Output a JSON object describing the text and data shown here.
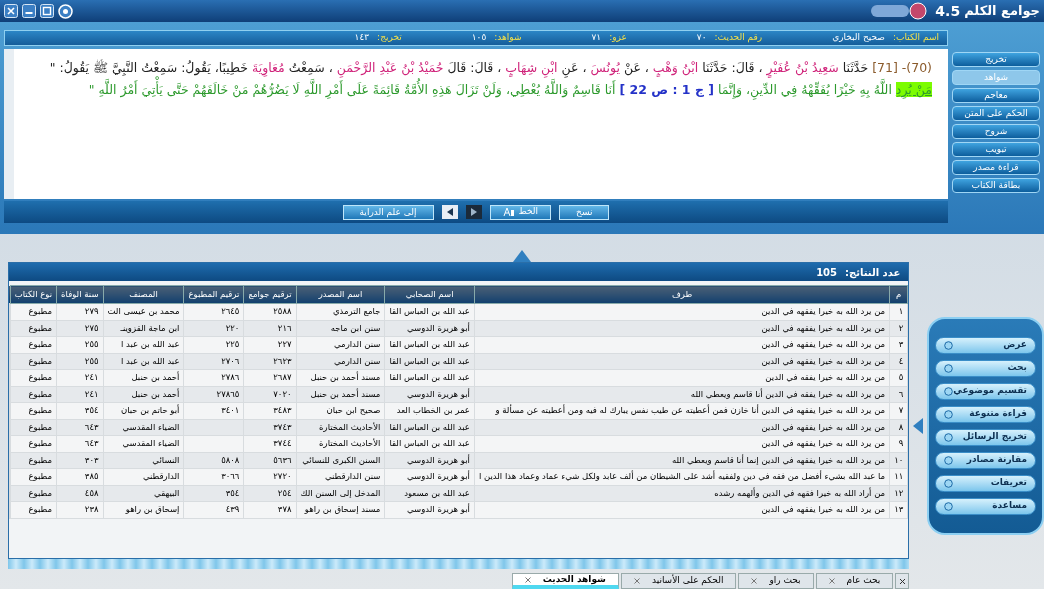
{
  "window": {
    "title": "جوامع الكلم",
    "version": "4.5"
  },
  "info_bar": [
    {
      "label": "اسم الكتاب:",
      "value": "صحيح البخاري"
    },
    {
      "label": "رقم الحديث:",
      "value": "٧٠"
    },
    {
      "label": "عزو:",
      "value": "٧١"
    },
    {
      "label": "شواهد:",
      "value": "١٠٥"
    },
    {
      "label": "تخريج:",
      "value": "١٤٣"
    }
  ],
  "hadith_text": [
    {
      "kind": "ref",
      "text": "(70)- [71]"
    },
    {
      "kind": "plain",
      "text": "حَدَّثَنَا"
    },
    {
      "kind": "narrator",
      "text": "سَعِيدُ بْنُ عُفَيْرٍ"
    },
    {
      "kind": "plain",
      "text": "، قَالَ: حَدَّثَنَا"
    },
    {
      "kind": "narrator",
      "text": "ابْنُ وَهْبٍ"
    },
    {
      "kind": "plain",
      "text": "، عَنْ"
    },
    {
      "kind": "narrator",
      "text": "يُونُسَ"
    },
    {
      "kind": "plain",
      "text": "، عَنِ"
    },
    {
      "kind": "narrator",
      "text": "ابْنِ شِهَابٍ"
    },
    {
      "kind": "plain",
      "text": "، قَالَ: قَالَ"
    },
    {
      "kind": "narrator",
      "text": "حُمَيْدُ بْنُ عَبْدِ الرَّحْمَنِ"
    },
    {
      "kind": "plain",
      "text": "، سَمِعْتُ"
    },
    {
      "kind": "narrator",
      "text": "مُعَاوِيَةَ"
    },
    {
      "kind": "plain",
      "text": "خَطِيبًا، يَقُولُ: سَمِعْتُ النَّبِيَّ ﷺ يَقُولُ: \""
    },
    {
      "kind": "highlight",
      "text": "مَنْ يُرِدِ"
    },
    {
      "kind": "matn",
      "text": "اللَّهُ بِهِ خَيْرًا يُفَقِّهْهُ فِي الدِّينِ، وَإِنَّمَا"
    },
    {
      "kind": "page",
      "text": "[ ج 1 : ص 22 ]"
    },
    {
      "kind": "matn",
      "text": "أَنَا قَاسِمٌ وَاللَّهُ يُعْطِي، وَلَنْ تَزَالَ هَذِهِ الأُمَّةُ قَائِمَةً عَلَى أَمْرِ اللَّهِ لَا يَضُرُّهُمْ مَنْ خَالَفَهُمْ حَتَّى يَأْتِيَ أَمْرُ اللَّهِ \""
    }
  ],
  "side_buttons": [
    {
      "label": "تخريج",
      "selected": false
    },
    {
      "label": "شواهد",
      "selected": true
    },
    {
      "label": "معاجم",
      "selected": false
    },
    {
      "label": "الحكم على المتن",
      "selected": false
    },
    {
      "label": "شروح",
      "selected": false
    },
    {
      "label": "تبويب",
      "selected": false
    },
    {
      "label": "قراءة مصدر",
      "selected": false
    },
    {
      "label": "بطاقة الكتاب",
      "selected": false
    }
  ],
  "toolbar": [
    {
      "kind": "text",
      "label": "نسخ"
    },
    {
      "kind": "font",
      "label": "الخط"
    },
    {
      "kind": "next"
    },
    {
      "kind": "prev"
    },
    {
      "kind": "text",
      "label": "إلى علم الدراية"
    }
  ],
  "results": {
    "count_label": "عدد النتائج:",
    "count": "105",
    "columns": [
      "م",
      "طرف",
      "اسم الصحابي",
      "اسم المصدر",
      "ترقيم جوامع",
      "ترقيم المطبوع",
      "المصنف",
      "سنة الوفاة",
      "نوع الكتاب"
    ],
    "rows": [
      [
        "١",
        "من يرد الله به خيرا يفقهه في الدين",
        "عبد الله بن العباس القا",
        "جامع الترمذي",
        "٢٥٨٨",
        "٢٦٤٥",
        "محمد بن عيسى الت",
        "٢٧٩",
        "مطبوع"
      ],
      [
        "٢",
        "من يرد الله به خيرا يفقهه في الدين",
        "أبو هريرة الدوسي",
        "سنن ابن ماجه",
        "٢١٦",
        "٢٢٠",
        "ابن ماجة القزوينـ",
        "٢٧٥",
        "مطبوع"
      ],
      [
        "٣",
        "من يرد الله به خيرا يفقهه في الدين",
        "عبد الله بن العباس القا",
        "سنن الدارمي",
        "٢٢٧",
        "٢٢٥",
        "عبد الله بن عبد ا",
        "٢٥٥",
        "مطبوع"
      ],
      [
        "٤",
        "من يرد الله به خيرا يفقهه في الدين",
        "عبد الله بن العباس القا",
        "سنن الدارمي",
        "٢٦٢٣",
        "٢٧٠٦",
        "عبد الله بن عبد ا",
        "٢٥٥",
        "مطبوع"
      ],
      [
        "٥",
        "من يرد الله به خيرا يفقه في الدين",
        "عبد الله بن العباس القا",
        "مسند أحمد بن حنبل",
        "٢٦٨٧",
        "٢٧٨٦",
        "أحمد بن حنبل",
        "٢٤١",
        "مطبوع"
      ],
      [
        "٦",
        "من يرد الله به خيرا يفقه في الدين أنا قاسم ويعطي الله",
        "أبو هريرة الدوسي",
        "مسند أحمد بن حنبل",
        "٧٠٢٠",
        "٢٧٨٦٥",
        "أحمد بن حنبل",
        "٢٤١",
        "مطبوع"
      ],
      [
        "٧",
        "من يرد الله به خيرا يفقهه في الدين أنا خازن فمن أعطيته عن طيب نفس يبارك له فيه ومن أعطيته عن مسألة و",
        "عمر بن الخطاب العد",
        "صحيح ابن حبان",
        "٣٤٨٣",
        "٣٤٠١",
        "أبو حاتم بن حبان",
        "٣٥٤",
        "مطبوع"
      ],
      [
        "٨",
        "من يرد الله به خيرا يفقهه في الدين",
        "عبد الله بن العباس القا",
        "الأحاديث المختارة",
        "٣٧٤٣",
        null,
        "الضياء المقدسي",
        "٦٤٣",
        "مطبوع"
      ],
      [
        "٩",
        "من يرد الله به خيرا يفقهه في الدين",
        "عبد الله بن العباس القا",
        "الأحاديث المختارة",
        "٣٧٤٤",
        null,
        "الضياء المقدسي",
        "٦٤٣",
        "مطبوع"
      ],
      [
        "١٠",
        "من يرد الله به خيرا يفقهه في الدين إنما أنا قاسم ويعطي الله",
        "أبو هريرة الدوسي",
        "السنن الكبرى للنسائي",
        "٥٦٣٦",
        "٥٨٠٨",
        "النسائي",
        "٣٠٣",
        "مطبوع"
      ],
      [
        "١١",
        "ما عبد الله بشيء أفضل من فقه في دين ولفقيه أشد على الشيطان من ألف عابد ولكل شيء عماد وعماد هذا الدين ا",
        "أبو هريرة الدوسي",
        "سنن الدارقطني",
        "٢٧٢٠",
        "٣٠٦٦",
        "الدارقطني",
        "٣٨٥",
        "مطبوع"
      ],
      [
        "١٢",
        "من أراد الله به خيرا فقهه في الدين وألهمه رشده",
        "عبد الله بن مسعود",
        "المدخل إلى السنن الك",
        "٢٥٤",
        "٣٥٤",
        "البيهقي",
        "٤٥٨",
        "مطبوع"
      ],
      [
        "١٣",
        "من يرد الله به خيرا يفقهه في الدين",
        "أبو هريرة الدوسي",
        "مسند إسحاق بن راهو",
        "٣٧٨",
        "٤٣٩",
        "إسحاق بن راهو",
        "٢٣٨",
        "مطبوع"
      ]
    ]
  },
  "nav_menu": [
    {
      "label": "عرض"
    },
    {
      "label": "بحث"
    },
    {
      "label": "تقسيم موضوعي"
    },
    {
      "label": "قراءة متنوعة"
    },
    {
      "label": "تخريج الرسائل"
    },
    {
      "label": "مقارنة مصادر"
    },
    {
      "label": "تعريفات"
    },
    {
      "label": "مساعدة"
    }
  ],
  "bottom_tabs": [
    {
      "label": "بحث عام",
      "selected": false
    },
    {
      "label": "بحث راو",
      "selected": false
    },
    {
      "label": "الحكم على الأسانيد",
      "selected": false
    },
    {
      "label": "شواهد الحديث",
      "selected": true
    }
  ]
}
